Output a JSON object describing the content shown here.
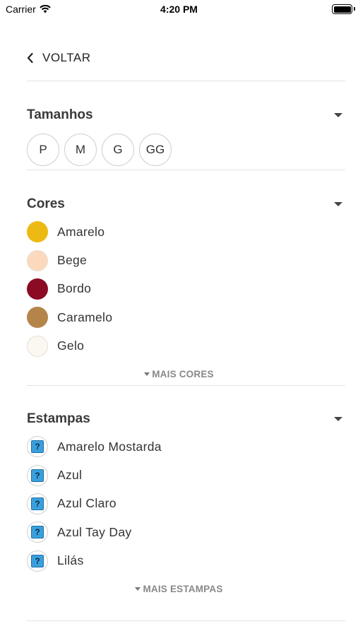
{
  "status_bar": {
    "carrier": "Carrier",
    "time": "4:20 PM"
  },
  "nav": {
    "back_label": "VOLTAR"
  },
  "sizes": {
    "title": "Tamanhos",
    "options": [
      "P",
      "M",
      "G",
      "GG"
    ]
  },
  "colors": {
    "title": "Cores",
    "items": [
      {
        "label": "Amarelo",
        "color": "#EDBA13"
      },
      {
        "label": "Bege",
        "color": "#FCD9BD"
      },
      {
        "label": "Bordo",
        "color": "#8B0B24"
      },
      {
        "label": "Caramelo",
        "color": "#B5844B"
      },
      {
        "label": "Gelo",
        "color": "#FBF8F1"
      }
    ],
    "more_label": "MAIS CORES"
  },
  "prints": {
    "title": "Estampas",
    "placeholder_icon": "?",
    "items": [
      {
        "label": "Amarelo Mostarda"
      },
      {
        "label": "Azul"
      },
      {
        "label": "Azul Claro"
      },
      {
        "label": "Azul Tay Day"
      },
      {
        "label": "Lilás"
      }
    ],
    "more_label": "MAIS ESTAMPAS"
  }
}
